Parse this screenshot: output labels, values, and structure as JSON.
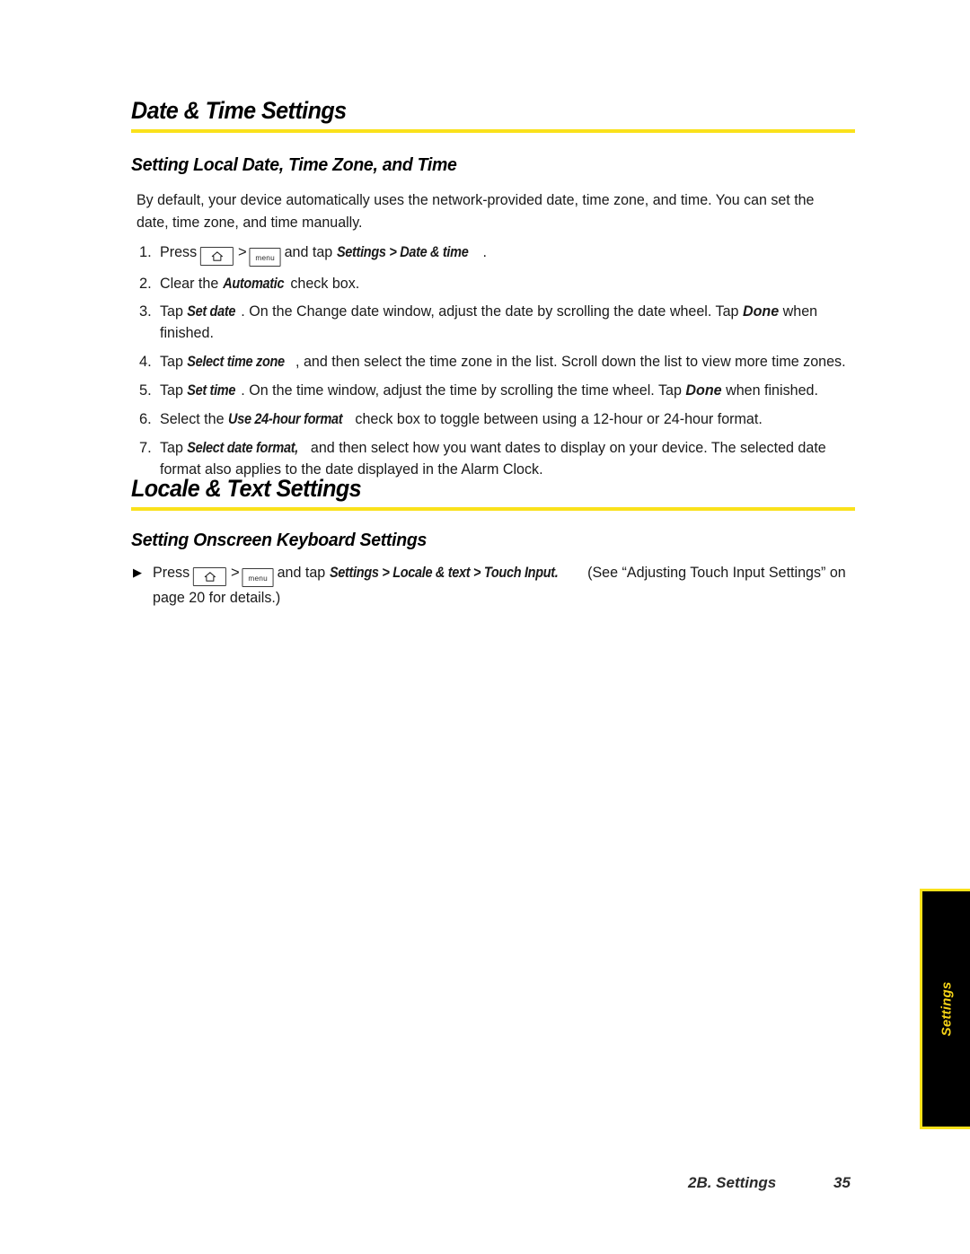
{
  "page": {
    "background_color": "#ffffff",
    "accent_rule_color": "#FAE11B"
  },
  "sections": [
    {
      "heading": "Date & Time Settings",
      "subheading": "Setting Local Date, Time Zone, and Time",
      "intro": "By default, your device automatically uses the network-provided date, time zone, and time. You can set the date, time zone, and time manually.",
      "steps": [
        {
          "number": "1.",
          "pre": "Press",
          "key_home": "home-icon",
          "separator": ">",
          "key_menu": "menu",
          "mid": "and tap",
          "emphasis": "Settings > Date & time",
          "post": "."
        },
        {
          "number": "2.",
          "pre": "Clear the",
          "emphasis": "Automatic",
          "post": "check box."
        },
        {
          "number": "3.",
          "pre": "Tap",
          "emphasis": "Set date",
          "mid": ". On the Change date window, adjust the date by scrolling the date wheel. Tap",
          "emphasis2": "Done",
          "post": "when finished."
        },
        {
          "number": "4.",
          "pre": "Tap",
          "emphasis": "Select time zone",
          "post": ", and then select the time zone in the list. Scroll down the list to view more time zones."
        },
        {
          "number": "5.",
          "pre": "Tap",
          "emphasis": "Set time",
          "mid": ". On the time window, adjust the time by scrolling the time wheel. Tap",
          "emphasis2": "Done",
          "post": "when finished."
        },
        {
          "number": "6.",
          "pre": "Select the",
          "emphasis": "Use 24-hour format",
          "post": "check box to toggle between using a 12-hour or 24-hour format."
        },
        {
          "number": "7.",
          "pre": "Tap",
          "emphasis": "Select date format,",
          "post": "and then select how you want dates to display on your device. The selected date format also applies to the date displayed in the Alarm Clock."
        }
      ]
    },
    {
      "heading": "Locale & Text Settings",
      "subheading": "Setting Onscreen Keyboard Settings",
      "bullet": {
        "marker": "▶",
        "pre": "Press",
        "key_home": "home-icon",
        "separator": ">",
        "key_menu": "menu",
        "mid": "and tap",
        "emphasis": "Settings > Locale & text > Touch Input.",
        "post": "(See “Adjusting Touch Input Settings” on page 20 for details.)"
      }
    }
  ],
  "side_tab": {
    "label": "Settings",
    "background_color": "#000000",
    "text_color": "#F7D417",
    "border_color": "#FAE11B"
  },
  "footer": {
    "chapter": "2B. Settings",
    "page_number": "35"
  }
}
